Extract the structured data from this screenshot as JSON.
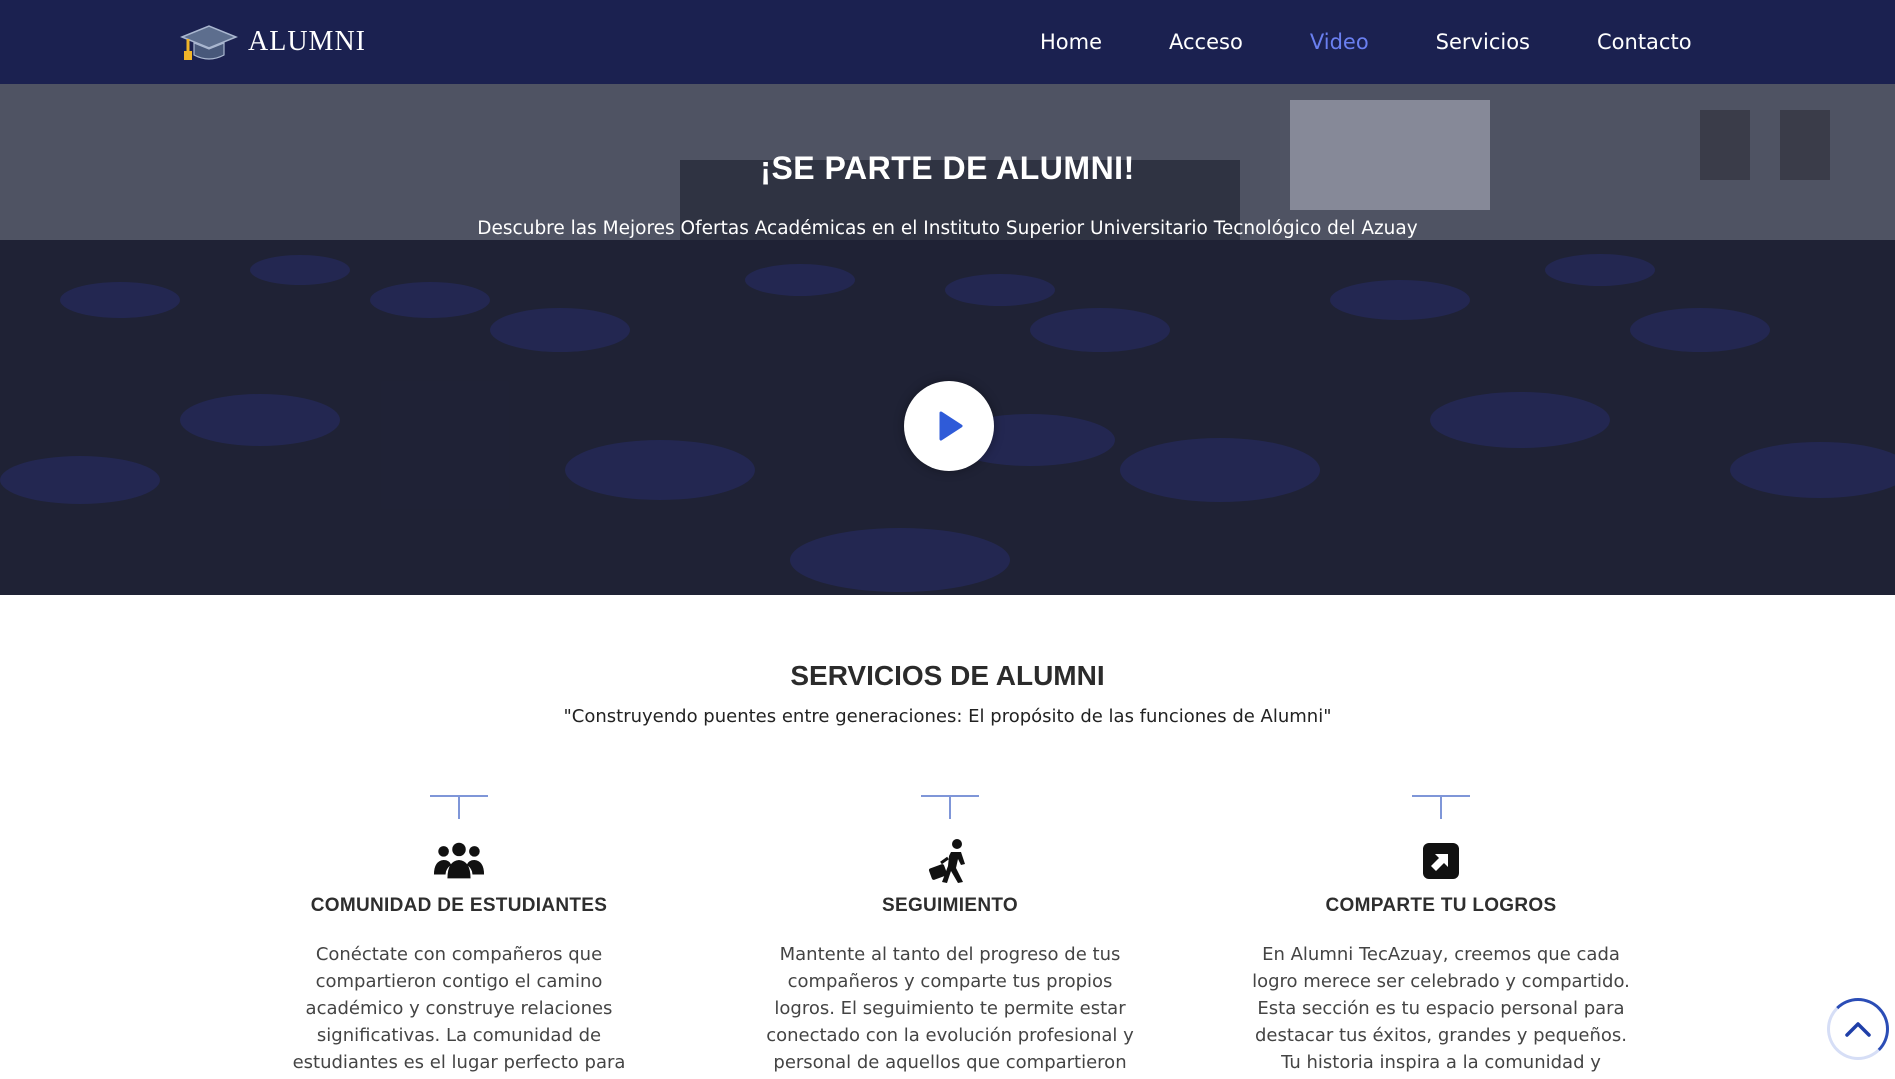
{
  "brand": {
    "name": "ALUMNI",
    "icon": "graduation-cap-icon"
  },
  "nav": {
    "items": [
      {
        "label": "Home",
        "active": false
      },
      {
        "label": "Acceso",
        "active": false
      },
      {
        "label": "Video",
        "active": true
      },
      {
        "label": "Servicios",
        "active": false
      },
      {
        "label": "Contacto",
        "active": false
      }
    ]
  },
  "hero": {
    "title": "¡SE PARTE DE ALUMNI!",
    "subtitle": "Descubre las Mejores Ofertas Académicas en el Instituto Superior Universitario Tecnológico del Azuay",
    "play_icon": "play-icon"
  },
  "services": {
    "title": "SERVICIOS DE ALUMNI",
    "subtitle": "\"Construyendo puentes entre generaciones: El propósito de las funciones de Alumni\"",
    "cards": [
      {
        "icon": "users-group-icon",
        "title": "COMUNIDAD DE ESTUDIANTES",
        "text": "Conéctate con compañeros que compartieron contigo el camino académico y construye relaciones significativas. La comunidad de estudiantes es el lugar perfecto para"
      },
      {
        "icon": "person-walking-luggage-icon",
        "title": "SEGUIMIENTO",
        "text": "Mantente al tanto del progreso de tus compañeros y comparte tus propios logros. El seguimiento te permite estar conectado con la evolución profesional y personal de aquellos que compartieron"
      },
      {
        "icon": "share-square-icon",
        "title": "COMPARTE TU LOGROS",
        "text": "En Alumni TecAzuay, creemos que cada logro merece ser celebrado y compartido. Esta sección es tu espacio personal para destacar tus éxitos, grandes y pequeños. Tu historia inspira a la comunidad y"
      }
    ]
  },
  "colors": {
    "navbar": "#1b2150",
    "nav_active": "#6a7ff0",
    "accent_line": "#7f96d8"
  },
  "scroll_top_icon": "chevron-up-icon"
}
